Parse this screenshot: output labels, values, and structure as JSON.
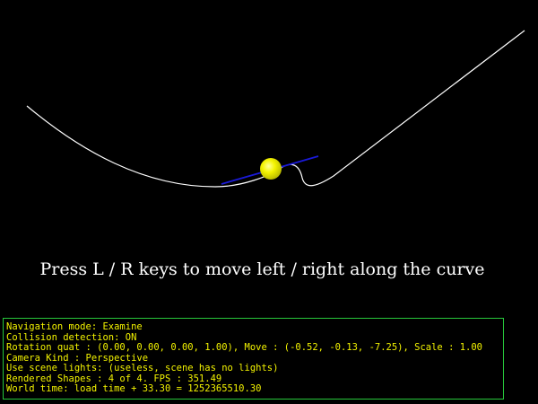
{
  "hint_text": "Press L / R keys to move left / right along the curve",
  "status": {
    "lines": [
      "Navigation mode: Examine",
      "Collision detection: ON",
      "Rotation quat : (0.00, 0.00, 0.00, 1.00), Move : (-0.52, -0.13, -7.25), Scale : 1.00",
      "Camera Kind : Perspective",
      "Use scene lights: (useless, scene has no lights)",
      "Rendered Shapes : 4 of 4. FPS : 351.49",
      "World time: load time + 33.30 = 1252365510.30"
    ]
  },
  "colors": {
    "background": "#000000",
    "curve": "#ffffff",
    "tangent": "#1a1ad8",
    "sphere": "#f0f000",
    "status_text": "#f3f300",
    "status_border": "#27c83a"
  }
}
